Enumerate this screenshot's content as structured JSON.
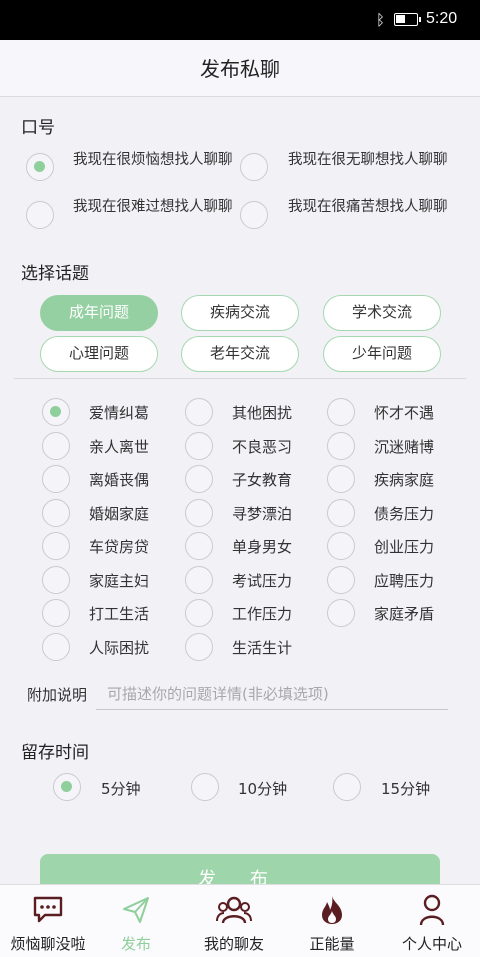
{
  "status_bar": {
    "time": "5:20",
    "battery_level": 0.45
  },
  "page_title": "发布私聊",
  "slogan": {
    "label": "口号",
    "options": [
      {
        "text": "我现在很烦恼想找人聊聊",
        "selected": true
      },
      {
        "text": "我现在很无聊想找人聊聊",
        "selected": false
      },
      {
        "text": "我现在很难过想找人聊聊",
        "selected": false
      },
      {
        "text": "我现在很痛苦想找人聊聊",
        "selected": false
      }
    ]
  },
  "topic": {
    "label": "选择话题",
    "categories": [
      "成年问题",
      "疾病交流",
      "学术交流",
      "心理问题",
      "老年交流",
      "少年问题"
    ],
    "selected_category": "成年问题",
    "subtopics": [
      "爱情纠葛",
      "其他困扰",
      "怀才不遇",
      "亲人离世",
      "不良恶习",
      "沉迷赌博",
      "离婚丧偶",
      "子女教育",
      "疾病家庭",
      "婚姻家庭",
      "寻梦漂泊",
      "债务压力",
      "车贷房贷",
      "单身男女",
      "创业压力",
      "家庭主妇",
      "考试压力",
      "应聘压力",
      "打工生活",
      "工作压力",
      "家庭矛盾",
      "人际困扰",
      "生活生计"
    ],
    "selected_subtopic": "爱情纠葛"
  },
  "additional": {
    "label": "附加说明",
    "placeholder": "可描述你的问题详情(非必填选项)",
    "value": ""
  },
  "duration": {
    "label": "留存时间",
    "options": [
      "5分钟",
      "10分钟",
      "15分钟"
    ],
    "selected": "5分钟"
  },
  "publish_label": "发 布",
  "tabs": [
    {
      "label": "烦恼聊没啦",
      "icon": "chat-bubble-icon",
      "active": false
    },
    {
      "label": "发布",
      "icon": "send-icon",
      "active": true
    },
    {
      "label": "我的聊友",
      "icon": "friends-icon",
      "active": false
    },
    {
      "label": "正能量",
      "icon": "fire-icon",
      "active": false
    },
    {
      "label": "个人中心",
      "icon": "person-icon",
      "active": false
    }
  ],
  "colors": {
    "accent": "#95d0a2",
    "tab_dark": "#5a1e22"
  }
}
